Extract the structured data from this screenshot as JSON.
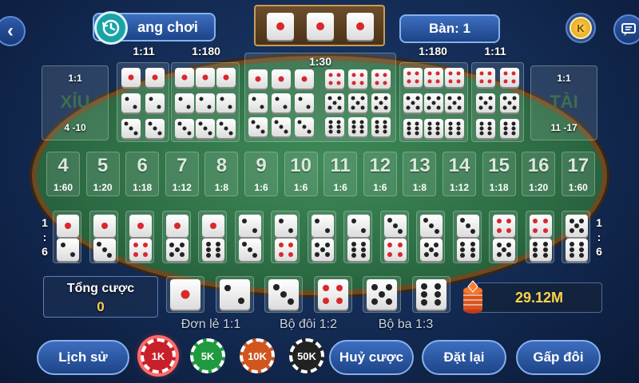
{
  "header": {
    "back_icon": "chevron-left-icon",
    "history_button_label": "ang chơi",
    "table_label": "Bàn: 1",
    "coin_label": "K",
    "chat_icon": "chat-icon",
    "result_dice": [
      1,
      1,
      1
    ]
  },
  "top_odds": {
    "pair_left": "1:11",
    "triple_left": "1:180",
    "any_triple": "1:30",
    "triple_right": "1:180",
    "pair_right": "1:11"
  },
  "small_bet": {
    "odds": "1:1",
    "label": "XỈU",
    "range": "4 -10"
  },
  "big_bet": {
    "odds": "1:1",
    "label": "TÀI",
    "range": "11 -17"
  },
  "pair_left_dice": [
    1,
    2,
    3
  ],
  "triple_left_dice": [
    1,
    2,
    3
  ],
  "any_triple_dice": [
    [
      1,
      4
    ],
    [
      2,
      5
    ],
    [
      3,
      6
    ]
  ],
  "triple_right_dice": [
    4,
    5,
    6
  ],
  "pair_right_dice": [
    4,
    5,
    6
  ],
  "sums": [
    {
      "n": "4",
      "odds": "1:60"
    },
    {
      "n": "5",
      "odds": "1:20"
    },
    {
      "n": "6",
      "odds": "1:18"
    },
    {
      "n": "7",
      "odds": "1:12"
    },
    {
      "n": "8",
      "odds": "1:8"
    },
    {
      "n": "9",
      "odds": "1:6"
    },
    {
      "n": "10",
      "odds": "1:6"
    },
    {
      "n": "11",
      "odds": "1:6"
    },
    {
      "n": "12",
      "odds": "1:6"
    },
    {
      "n": "13",
      "odds": "1:8"
    },
    {
      "n": "14",
      "odds": "1:12"
    },
    {
      "n": "15",
      "odds": "1:18"
    },
    {
      "n": "16",
      "odds": "1:20"
    },
    {
      "n": "17",
      "odds": "1:60"
    }
  ],
  "combo_odds_left": [
    "1",
    ":",
    "6"
  ],
  "combo_odds_right": [
    "1",
    ":",
    "6"
  ],
  "combos": [
    [
      1,
      2
    ],
    [
      1,
      3
    ],
    [
      1,
      4
    ],
    [
      1,
      5
    ],
    [
      1,
      6
    ],
    [
      2,
      3
    ],
    [
      2,
      4
    ],
    [
      2,
      5
    ],
    [
      2,
      6
    ],
    [
      3,
      4
    ],
    [
      3,
      5
    ],
    [
      3,
      6
    ],
    [
      4,
      5
    ],
    [
      4,
      6
    ],
    [
      5,
      6
    ]
  ],
  "total_bet": {
    "label": "Tổng cược",
    "value": "0"
  },
  "single_dice": [
    1,
    2,
    3,
    4,
    5,
    6
  ],
  "single_labels": {
    "single": "Đơn lẻ 1:1",
    "double": "Bộ đôi 1:2",
    "triple": "Bộ ba 1:3"
  },
  "balance": "29.12M",
  "buttons": {
    "history": "Lịch sử",
    "cancel": "Huỷ cược",
    "reset": "Đặt lại",
    "double": "Gấp đôi"
  },
  "chips": [
    {
      "label": "1K",
      "color": "#c8202a"
    },
    {
      "label": "5K",
      "color": "#1f9a3e"
    },
    {
      "label": "10K",
      "color": "#d0561e"
    },
    {
      "label": "50K",
      "color": "#222222"
    }
  ]
}
